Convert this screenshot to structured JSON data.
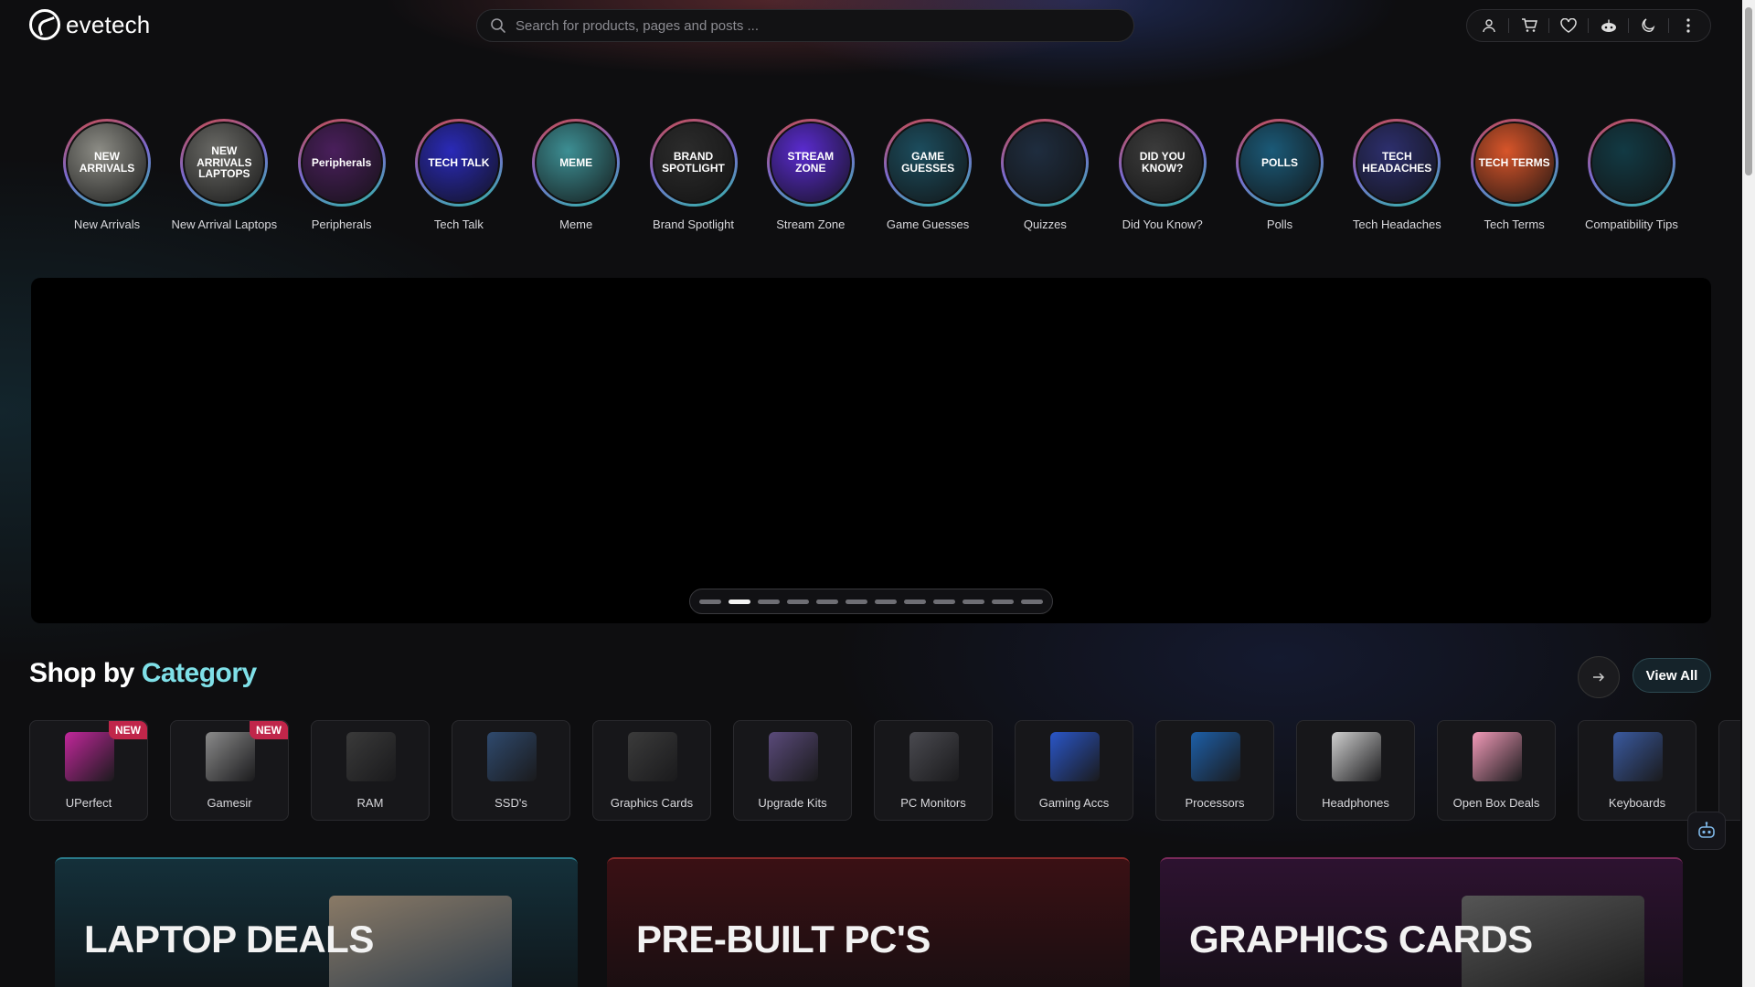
{
  "header": {
    "logo_text": "evetech",
    "search_placeholder": "Search for products, pages and posts ...",
    "actions": [
      "user-icon",
      "cart-icon",
      "heart-icon",
      "bot-icon",
      "moon-icon",
      "more-icon"
    ]
  },
  "stories": [
    {
      "label": "New Arrivals",
      "art": "NEW ARRIVALS",
      "bg": "#8d8d86"
    },
    {
      "label": "New Arrival Laptops",
      "art": "NEW ARRIVALS LAPTOPS",
      "bg": "#6a6a66"
    },
    {
      "label": "Peripherals",
      "art": "Peripherals",
      "bg": "#4a1f5c"
    },
    {
      "label": "Tech Talk",
      "art": "TECH TALK",
      "bg": "#2a2ab8"
    },
    {
      "label": "Meme",
      "art": "MEME",
      "bg": "#3d8f94"
    },
    {
      "label": "Brand Spotlight",
      "art": "BRAND SPOTLIGHT",
      "bg": "#2c2c2c"
    },
    {
      "label": "Stream Zone",
      "art": "STREAM ZONE",
      "bg": "#5a2bd0"
    },
    {
      "label": "Game Guesses",
      "art": "GAME GUESSES",
      "bg": "#1c4d5e"
    },
    {
      "label": "Quizzes",
      "art": "",
      "bg": "#1f2d3f"
    },
    {
      "label": "Did You Know?",
      "art": "DID YOU KNOW?",
      "bg": "#3c3c3c"
    },
    {
      "label": "Polls",
      "art": "POLLS",
      "bg": "#1b5a78"
    },
    {
      "label": "Tech Headaches",
      "art": "TECH HEADACHES",
      "bg": "#2d2f6e"
    },
    {
      "label": "Tech Terms",
      "art": "TECH TERMS",
      "bg": "#d8552a"
    },
    {
      "label": "Compatibility Tips",
      "art": "",
      "bg": "#123a44"
    }
  ],
  "carousel": {
    "slides": 12,
    "active_index": 1
  },
  "category": {
    "title_main": "Shop by",
    "title_accent": "Category",
    "view_all": "View All",
    "items": [
      {
        "name": "UPerfect",
        "badge": "NEW",
        "color": "#c2279b"
      },
      {
        "name": "Gamesir",
        "badge": "NEW",
        "color": "#8a8a8a"
      },
      {
        "name": "RAM",
        "badge": "",
        "color": "#3a3a3a"
      },
      {
        "name": "SSD's",
        "badge": "",
        "color": "#2f4a6e"
      },
      {
        "name": "Graphics Cards",
        "badge": "",
        "color": "#3b3b3b"
      },
      {
        "name": "Upgrade Kits",
        "badge": "",
        "color": "#5a4a7a"
      },
      {
        "name": "PC Monitors",
        "badge": "",
        "color": "#4a4a50"
      },
      {
        "name": "Gaming Accs",
        "badge": "",
        "color": "#2a56c8"
      },
      {
        "name": "Processors",
        "badge": "",
        "color": "#1d5fa8"
      },
      {
        "name": "Headphones",
        "badge": "",
        "color": "#cfcfcf"
      },
      {
        "name": "Open Box Deals",
        "badge": "",
        "color": "#f29ab8"
      },
      {
        "name": "Keyboards",
        "badge": "",
        "color": "#3a5aa0"
      }
    ]
  },
  "promos": [
    {
      "title": "LAPTOP DEALS",
      "bg": "#14303a"
    },
    {
      "title": "PRE-BUILT PC'S",
      "bg": "#3a1014"
    },
    {
      "title": "GRAPHICS CARDS",
      "bg": "#2d1230"
    }
  ]
}
